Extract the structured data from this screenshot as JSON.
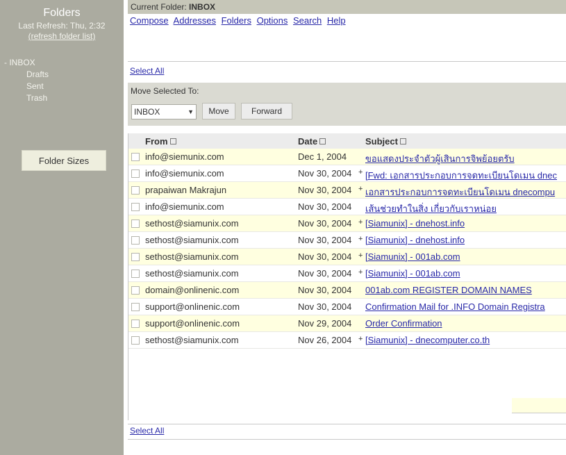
{
  "sidebar": {
    "title": "Folders",
    "last_refresh": "Last Refresh: Thu, 2:32",
    "refresh_link": "(refresh folder list)",
    "folders": [
      {
        "label": "- INBOX",
        "sub": false
      },
      {
        "label": "Drafts",
        "sub": true
      },
      {
        "label": "Sent",
        "sub": true
      },
      {
        "label": "Trash",
        "sub": true
      }
    ],
    "folder_sizes_button": "Folder Sizes"
  },
  "header": {
    "current_folder_label": "Current Folder:",
    "current_folder": "INBOX"
  },
  "menu": [
    "Compose",
    "Addresses",
    "Folders",
    "Options",
    "Search",
    "Help"
  ],
  "select_all": "Select All",
  "move_panel": {
    "label": "Move Selected To:",
    "selected_folder": "INBOX",
    "move_button": "Move",
    "forward_button": "Forward"
  },
  "columns": {
    "from": "From",
    "date": "Date",
    "subject": "Subject"
  },
  "messages": [
    {
      "from": "info@siemunix.com",
      "date": "Dec 1, 2004",
      "flag": "",
      "subject": "ขอแสดงประจำตัวผู้เสินการจิพย้อยตรับ",
      "hl": true
    },
    {
      "from": "info@siemunix.com",
      "date": "Nov 30, 2004",
      "flag": "+",
      "subject": "[Fwd: เอกสารประกอบการจดทะเบียนโดเมน dnec",
      "hl": false
    },
    {
      "from": "prapaiwan Makrajun",
      "date": "Nov 30, 2004",
      "flag": "+",
      "subject": "เอกสารประกอบการจดทะเบียนโดเมน dnecompu",
      "hl": true
    },
    {
      "from": "info@siemunix.com",
      "date": "Nov 30, 2004",
      "flag": "",
      "subject": "เส้นช่วยทำในสิ่ง เกี่ยวกับเราหน่อย",
      "hl": false
    },
    {
      "from": "sethost@siamunix.com",
      "date": "Nov 30, 2004",
      "flag": "+",
      "subject": "[Siamunix] - dnehost.info",
      "hl": true
    },
    {
      "from": "sethost@siamunix.com",
      "date": "Nov 30, 2004",
      "flag": "+",
      "subject": "[Siamunix] - dnehost.info",
      "hl": false
    },
    {
      "from": "sethost@siamunix.com",
      "date": "Nov 30, 2004",
      "flag": "+",
      "subject": "[Siamunix] - 001ab.com",
      "hl": true
    },
    {
      "from": "sethost@siamunix.com",
      "date": "Nov 30, 2004",
      "flag": "+",
      "subject": "[Siamunix] - 001ab.com",
      "hl": false
    },
    {
      "from": "domain@onlinenic.com",
      "date": "Nov 30, 2004",
      "flag": "",
      "subject": "001ab.com REGISTER DOMAIN NAMES",
      "hl": true
    },
    {
      "from": "support@onlinenic.com",
      "date": "Nov 30, 2004",
      "flag": "",
      "subject": "Confirmation Mail for .INFO Domain Registra",
      "hl": false
    },
    {
      "from": "support@onlinenic.com",
      "date": "Nov 29, 2004",
      "flag": "",
      "subject": "Order Confirmation",
      "hl": true
    },
    {
      "from": "sethost@siamunix.com",
      "date": "Nov 26, 2004",
      "flag": "+",
      "subject": "[Siamunix] - dnecomputer.co.th",
      "hl": false
    }
  ]
}
